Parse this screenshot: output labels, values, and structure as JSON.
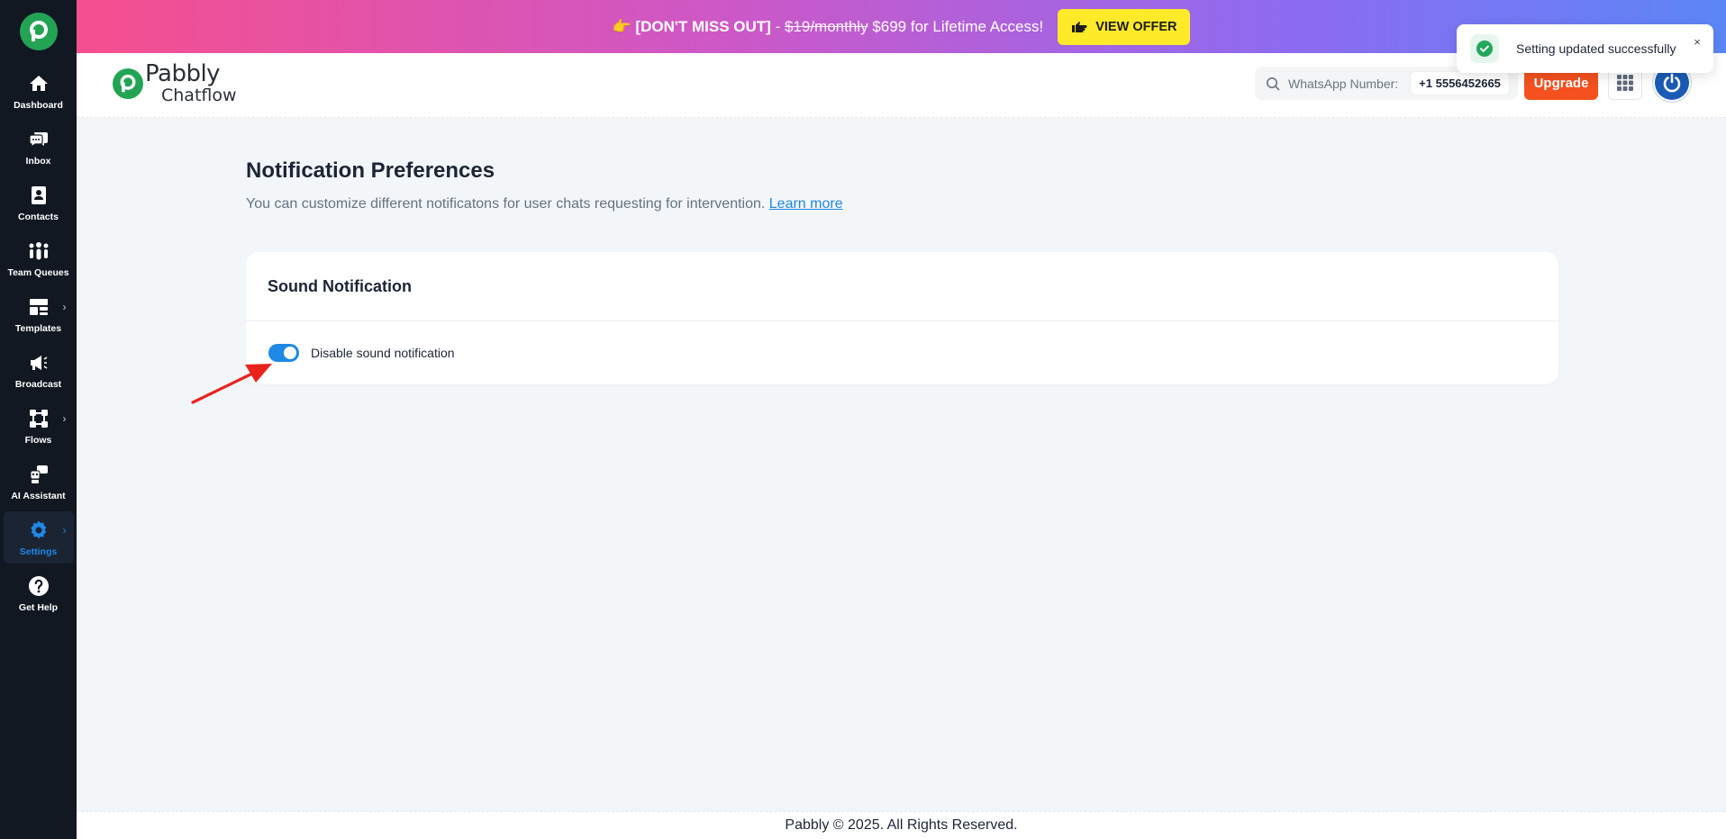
{
  "promo": {
    "emoji": "👉",
    "headline": "[DON'T MISS OUT]",
    "dash": " - ",
    "old_price": "$19/monthly",
    "offer": " $699 for Lifetime Access!",
    "button_label": "VIEW OFFER"
  },
  "sidebar": {
    "items": [
      {
        "label": "Dashboard",
        "icon": "home-icon"
      },
      {
        "label": "Inbox",
        "icon": "chat-icon"
      },
      {
        "label": "Contacts",
        "icon": "contact-book-icon"
      },
      {
        "label": "Team Queues",
        "icon": "team-icon"
      },
      {
        "label": "Templates",
        "icon": "template-icon"
      },
      {
        "label": "Broadcast",
        "icon": "megaphone-icon"
      },
      {
        "label": "Flows",
        "icon": "flow-icon"
      },
      {
        "label": "AI Assistant",
        "icon": "robot-icon"
      },
      {
        "label": "Settings",
        "icon": "gear-icon",
        "active": true
      },
      {
        "label": "Get Help",
        "icon": "help-icon"
      }
    ]
  },
  "header": {
    "brand_name": "Pabbly",
    "brand_sub": "Chatflow",
    "whatsapp_label": "WhatsApp Number:",
    "whatsapp_number": "+1 5556452665",
    "upgrade_label": "Upgrade"
  },
  "toast": {
    "message": "Setting updated successfully",
    "close": "×"
  },
  "main": {
    "title": "Notification Preferences",
    "description": "You can customize different notificatons for user chats requesting for intervention.",
    "learn_more": "Learn more",
    "card": {
      "title": "Sound Notification",
      "toggle_label": "Disable sound notification",
      "toggle_on": true
    }
  },
  "footer": {
    "text": "Pabbly © 2025. All Rights Reserved."
  },
  "colors": {
    "sidebar_bg": "#111822",
    "brand_green": "#23a455",
    "accent_blue": "#1e88e5",
    "upgrade_orange": "#f4511e",
    "promo_button": "#ffea2a"
  }
}
